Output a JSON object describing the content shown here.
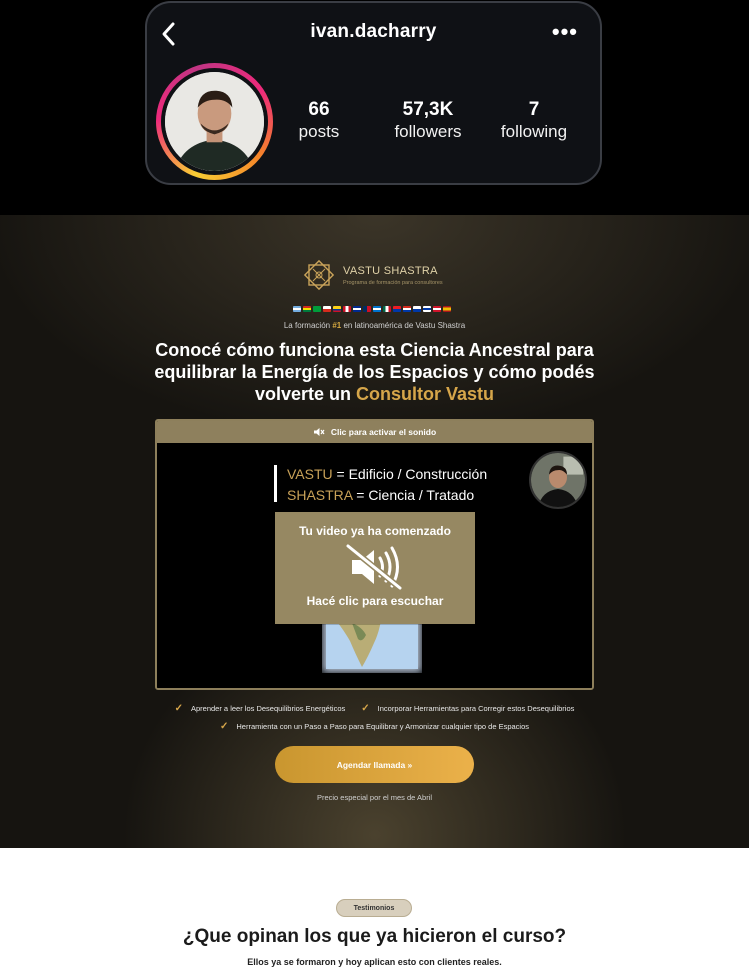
{
  "instagram": {
    "username": "ivan.dacharry",
    "more_icon": "more-horizontal-icon",
    "back_icon": "chevron-left-icon",
    "stats": [
      {
        "value": "66",
        "label": "posts"
      },
      {
        "value": "57,3K",
        "label": "followers"
      },
      {
        "value": "7",
        "label": "following"
      }
    ]
  },
  "landing": {
    "brand_name": "VASTU SHASTRA",
    "brand_sub": "Programa de formación para consultores",
    "tagline_pre": "La formación ",
    "tagline_hl": "#1",
    "tagline_post": " en latinoamérica de Vastu Shastra",
    "headline_line1": "Conocé cómo funciona esta Ciencia Ancestral para",
    "headline_line2": "equilibrar la Energía de los Espacios y cómo podés",
    "headline_line3_pre": "volverte un ",
    "headline_line3_gold": "Consultor Vastu",
    "video": {
      "sound_bar": "Clic para activar el sonido",
      "line1_gold": "VASTU",
      "line1_rest": " = Edificio / Construcción",
      "line2_gold": "SHASTRA",
      "line2_rest": " = Ciencia / Tratado",
      "overlay_top": "Tu video ya ha comenzado",
      "overlay_bottom": "Hacé clic para escuchar"
    },
    "bullets": [
      "Aprender a leer los Desequilibrios Energéticos",
      "Incorporar Herramientas para Corregir estos Desequilibrios",
      "Herramienta con un Paso a Paso para Equilibrar y Armonizar cualquier tipo de Espacios"
    ],
    "cta": "Agendar llamada »",
    "price_note": "Precio  especial por el mes de Abril",
    "colors": {
      "gold": "#d6a64a",
      "bar": "#8e805d"
    }
  },
  "testimonials": {
    "pill": "Testimonios",
    "title": "¿Que opinan los que ya hicieron el curso?",
    "subtitle": "Ellos ya se formaron y hoy aplican esto con clientes reales."
  }
}
